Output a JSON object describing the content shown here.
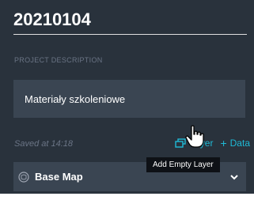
{
  "project": {
    "title": "20210104",
    "description_label": "PROJECT DESCRIPTION",
    "description_value": "Materiały szkoleniowe",
    "saved_text": "Saved at 14:18"
  },
  "actions": {
    "add_layer_label": "Layer",
    "add_data_label": "Data",
    "add_data_prefix": "+"
  },
  "basemap": {
    "label": "Base Map",
    "icon": "basemap-icon",
    "expand_icon": "chevron-down-icon"
  },
  "tooltip": {
    "text": "Add Empty Layer"
  },
  "colors": {
    "panel_bg": "#29323c",
    "input_bg": "#3a4552",
    "accent": "#1fbad6",
    "muted_text": "#6a7485",
    "tooltip_bg": "#0e1116"
  }
}
